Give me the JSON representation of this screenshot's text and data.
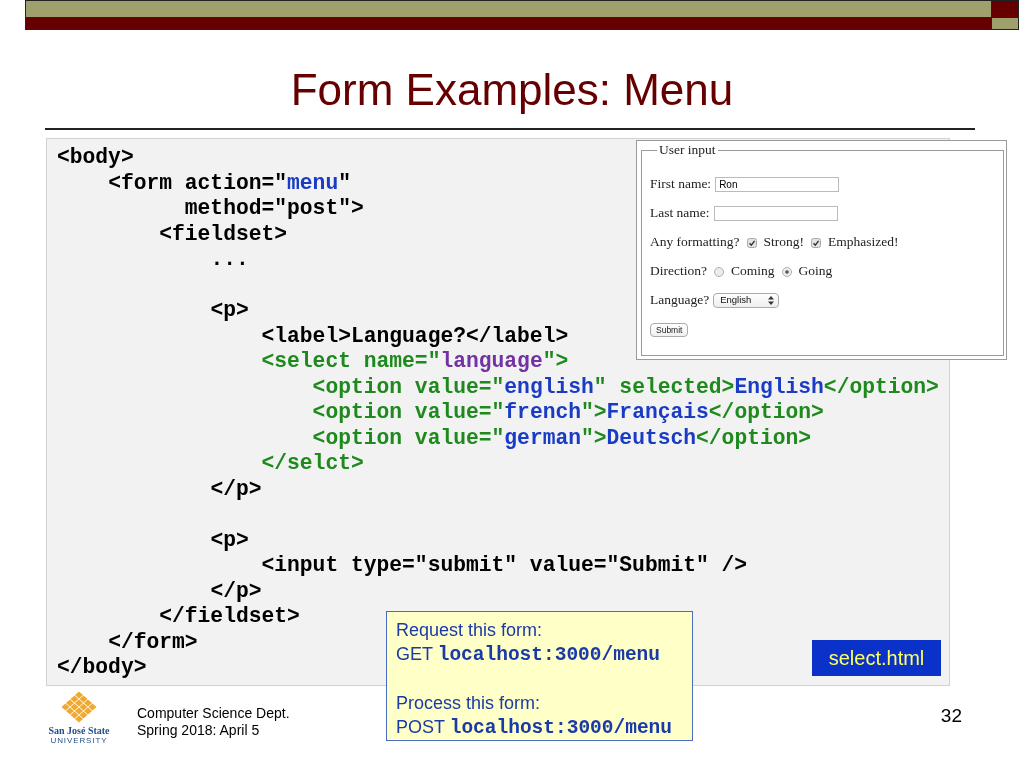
{
  "title": "Form Examples: Menu",
  "code_panel": {
    "blocks": [
      {
        "lines": [
          {
            "tokens": [
              {
                "text": "<body>",
                "kind": "plain"
              }
            ]
          },
          {
            "tokens": [
              {
                "text": "    <form action=\"",
                "kind": "plain"
              },
              {
                "text": "menu",
                "kind": "value"
              },
              {
                "text": "\"",
                "kind": "plain"
              }
            ]
          },
          {
            "tokens": [
              {
                "text": "          method=\"post\">",
                "kind": "plain"
              }
            ]
          },
          {
            "tokens": [
              {
                "text": "        <fieldset>",
                "kind": "plain"
              }
            ]
          },
          {
            "tokens": [
              {
                "text": "            ...",
                "kind": "plain"
              }
            ]
          }
        ]
      },
      {
        "lines": [
          {
            "tokens": [
              {
                "text": "            <p>",
                "kind": "plain"
              }
            ]
          },
          {
            "tokens": [
              {
                "text": "                <label>Language?</label>",
                "kind": "plain"
              }
            ]
          },
          {
            "tokens": [
              {
                "text": "                <select name=\"",
                "kind": "tag"
              },
              {
                "text": "language",
                "kind": "name"
              },
              {
                "text": "\">",
                "kind": "tag"
              }
            ]
          },
          {
            "tokens": [
              {
                "text": "                    <option value=\"",
                "kind": "tag"
              },
              {
                "text": "english",
                "kind": "value"
              },
              {
                "text": "\" selected>",
                "kind": "tag"
              },
              {
                "text": "English",
                "kind": "value"
              },
              {
                "text": "</option>",
                "kind": "tag"
              }
            ]
          },
          {
            "tokens": [
              {
                "text": "                    <option value=\"",
                "kind": "tag"
              },
              {
                "text": "french",
                "kind": "value"
              },
              {
                "text": "\">",
                "kind": "tag"
              },
              {
                "text": "Français",
                "kind": "value"
              },
              {
                "text": "</option>",
                "kind": "tag"
              }
            ]
          },
          {
            "tokens": [
              {
                "text": "                    <option value=\"",
                "kind": "tag"
              },
              {
                "text": "german",
                "kind": "value"
              },
              {
                "text": "\">",
                "kind": "tag"
              },
              {
                "text": "Deutsch",
                "kind": "value"
              },
              {
                "text": "</option>",
                "kind": "tag"
              }
            ]
          },
          {
            "tokens": [
              {
                "text": "                </selct>",
                "kind": "tag"
              }
            ]
          },
          {
            "tokens": [
              {
                "text": "            </p>",
                "kind": "plain"
              }
            ]
          }
        ]
      },
      {
        "lines": [
          {
            "tokens": [
              {
                "text": "            <p>",
                "kind": "plain"
              }
            ]
          },
          {
            "tokens": [
              {
                "text": "                <input type=\"submit\" value=\"Submit\" />",
                "kind": "plain"
              }
            ]
          },
          {
            "tokens": [
              {
                "text": "            </p>",
                "kind": "plain"
              }
            ]
          },
          {
            "tokens": [
              {
                "text": "        </fieldset>",
                "kind": "plain"
              }
            ]
          },
          {
            "tokens": [
              {
                "text": "    </form>",
                "kind": "plain"
              }
            ]
          },
          {
            "tokens": [
              {
                "text": "</body>",
                "kind": "plain"
              }
            ]
          }
        ]
      }
    ]
  },
  "form_screenshot": {
    "legend": "User input",
    "rows": [
      {
        "kind": "text",
        "label": "First name:",
        "value": "Ron"
      },
      {
        "kind": "text",
        "label": "Last name:"
      },
      {
        "kind": "checkboxes",
        "label": "Any formatting?",
        "options": [
          {
            "label": "Strong!",
            "checked": true
          },
          {
            "label": "Emphasized!",
            "checked": true
          }
        ]
      },
      {
        "kind": "radios",
        "label": "Direction?",
        "options": [
          {
            "label": "Coming",
            "selected": false
          },
          {
            "label": "Going",
            "selected": true
          }
        ]
      },
      {
        "kind": "select",
        "label": "Language?",
        "value": "English"
      },
      {
        "kind": "submit",
        "label": "Submit"
      }
    ]
  },
  "callout": {
    "sections": [
      {
        "heading": "Request this form:",
        "method": "GET",
        "url": "localhost:3000/menu"
      },
      {
        "heading": "Process this form:",
        "method": "POST",
        "url": "localhost:3000/menu"
      }
    ]
  },
  "file_label": "select.html",
  "logo": {
    "name": "San José State",
    "subtitle": "UNIVERSITY"
  },
  "footer": {
    "lines": [
      "Computer Science Dept.",
      "Spring 2018: April 5"
    ],
    "page_number": "32"
  }
}
